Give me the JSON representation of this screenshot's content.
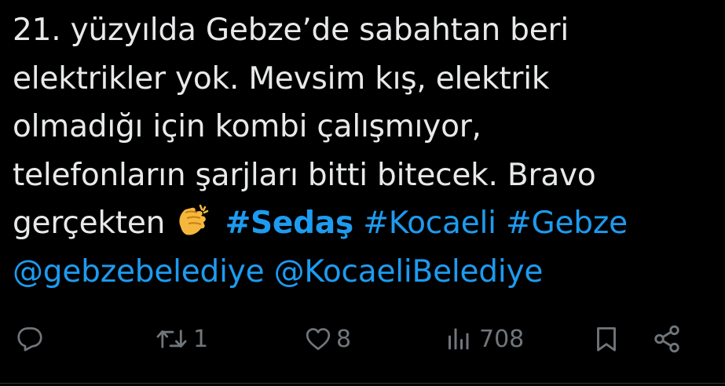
{
  "tweet": {
    "lines": [
      "21. yüzyılda Gebze’de sabahtan beri",
      "elektrikler yok. Mevsim kış, elektrik",
      "olmadığı için kombi çalışmıyor,",
      "telefonların şarjları bitti bitecek. Bravo"
    ],
    "line5_text": "gerçekten",
    "emoji": "clapping-hands",
    "hashtags": [
      "#Sedaş",
      "#Kocaeli",
      "#Gebze"
    ],
    "mentions": [
      "@gebzebelediye",
      "@KocaeliBelediye"
    ]
  },
  "actions": {
    "reply_icon": "reply-icon",
    "retweet_icon": "retweet-icon",
    "retweet_count": "1",
    "like_icon": "heart-icon",
    "like_count": "8",
    "views_icon": "views-icon",
    "views_count": "708",
    "bookmark_icon": "bookmark-icon",
    "share_icon": "share-icon"
  },
  "colors": {
    "background": "#000000",
    "text": "#e7e9ea",
    "link": "#1d9bf0",
    "muted": "#71767b"
  }
}
